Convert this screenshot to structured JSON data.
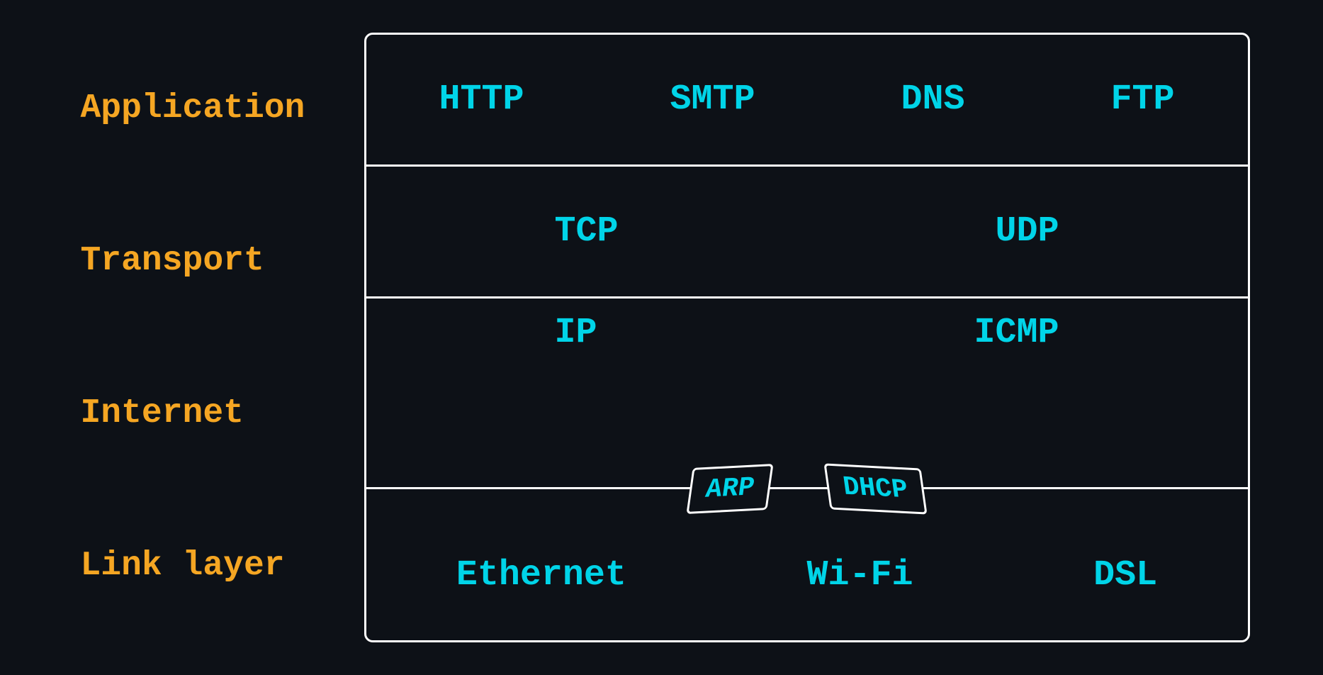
{
  "layers": {
    "application": {
      "label": "Application",
      "protocols": [
        "HTTP",
        "SMTP",
        "DNS",
        "FTP"
      ]
    },
    "transport": {
      "label": "Transport",
      "protocols": [
        "TCP",
        "UDP"
      ]
    },
    "internet": {
      "label": "Internet",
      "protocols_top": [
        "IP",
        "ICMP"
      ],
      "protocols_bottom": [
        "ARP",
        "DHCP"
      ]
    },
    "link": {
      "label": "Link layer",
      "protocols": [
        "Ethernet",
        "Wi-Fi",
        "DSL"
      ]
    }
  },
  "colors": {
    "label": "#f5a623",
    "protocol": "#00d4e8",
    "background": "#0d1117",
    "border": "#ffffff"
  }
}
